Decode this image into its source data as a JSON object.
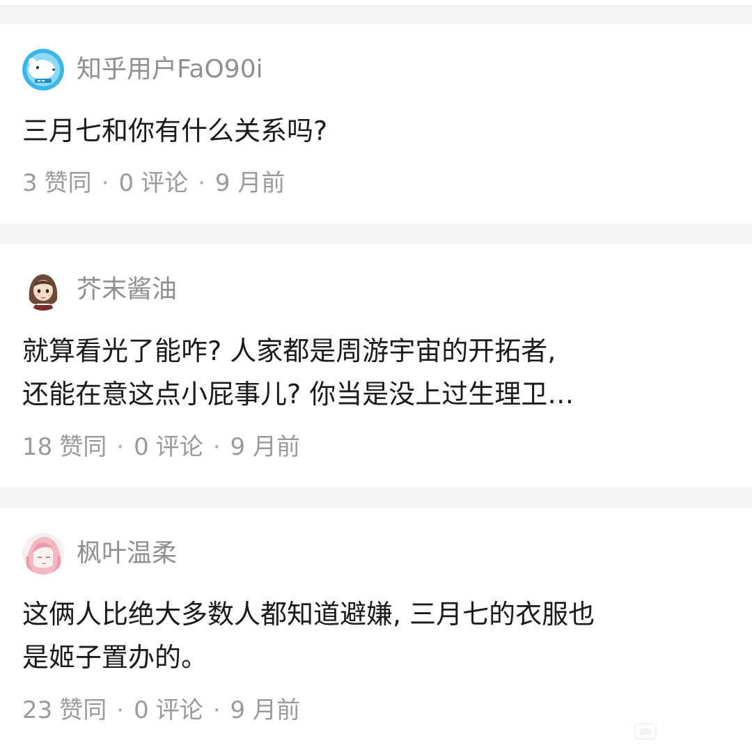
{
  "comments": [
    {
      "author": "知乎用户FaO90i",
      "avatar_icon": "polar-bear-avatar",
      "lines": [
        "三月七和你有什么关系吗?"
      ],
      "likes": "3",
      "likes_label": "赞同",
      "comments_count": "0",
      "comments_label": "评论",
      "time": "9 月前"
    },
    {
      "author": "芥末酱油",
      "avatar_icon": "anime-girl-avatar",
      "lines": [
        "就算看光了能咋? 人家都是周游宇宙的开拓者,",
        "还能在意这点小屁事儿? 你当是没上过生理卫…"
      ],
      "likes": "18",
      "likes_label": "赞同",
      "comments_count": "0",
      "comments_label": "评论",
      "time": "9 月前"
    },
    {
      "author": "枫叶温柔",
      "avatar_icon": "pink-hair-avatar",
      "lines": [
        "这俩人比绝大多数人都知道避嫌, 三月七的衣服也",
        "是姬子置办的。"
      ],
      "likes": "23",
      "likes_label": "赞同",
      "comments_count": "0",
      "comments_label": "评论",
      "time": "9 月前"
    }
  ],
  "separator": "·",
  "colors": {
    "background": "#f6f4f6",
    "card": "#ffffff",
    "text": "#1a1a1a",
    "secondary_text": "#8e8e93"
  }
}
